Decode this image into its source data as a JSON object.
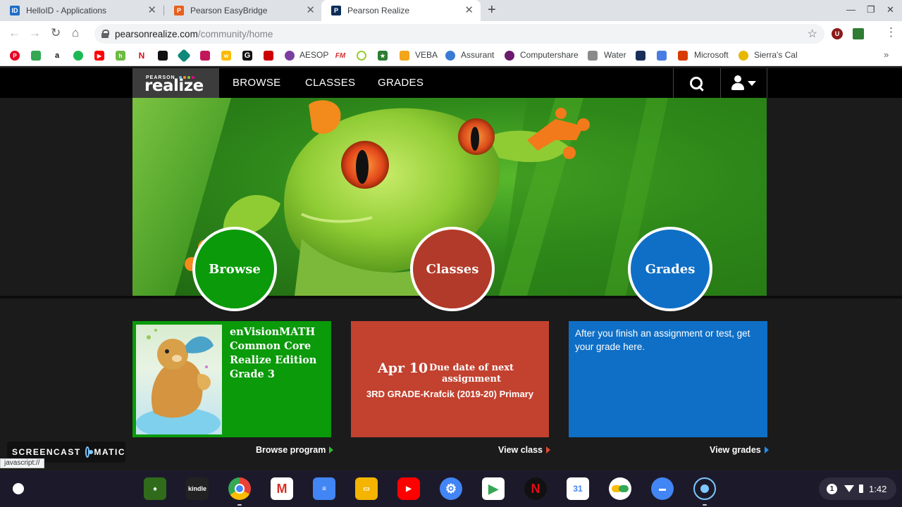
{
  "tabs": [
    {
      "label": "HelloID - Applications",
      "favicon": "HelloID",
      "favicon_text": "ID",
      "color": "#1f6fc8"
    },
    {
      "label": "Pearson EasyBridge",
      "favicon": "Pearson",
      "favicon_text": "P",
      "color": "#e8601c"
    },
    {
      "label": "Pearson Realize",
      "favicon": "Pearson",
      "favicon_text": "P",
      "color": "#0c2d5a",
      "active": true
    }
  ],
  "address": {
    "host": "pearsonrealize.com",
    "path": "/community/home"
  },
  "bookmarks": [
    {
      "label": "AESOP",
      "color": "#7b3fa0",
      "icon": "aesop-icon"
    },
    {
      "label": "VEBA",
      "color": "#f3a51b",
      "icon": "veba-icon"
    },
    {
      "label": "Assurant",
      "color": "#3a7bd5",
      "icon": "assurant-icon"
    },
    {
      "label": "Computershare",
      "color": "#6a1b6e",
      "icon": "computershare-icon"
    },
    {
      "label": "Water",
      "color": "#8a8a8a",
      "icon": "water-icon"
    },
    {
      "label": "Microsoft",
      "color": "#d83b01",
      "icon": "microsoft-icon"
    },
    {
      "label": "Sierra's Cal",
      "color": "#e6b800",
      "icon": "sierra-icon"
    }
  ],
  "nav": {
    "logo_small": "PEARSON",
    "logo_main": "realize",
    "logo_dot_colors": [
      "#6ec1e4",
      "#f7941d",
      "#8dc63f",
      "#ec008c"
    ],
    "browse": "BROWSE",
    "classes": "CLASSES",
    "grades": "GRADES"
  },
  "circles": {
    "browse": {
      "label": "Browse",
      "color": "#0a9a0a"
    },
    "classes": {
      "label": "Classes",
      "color": "#b23a2a"
    },
    "grades": {
      "label": "Grades",
      "color": "#0f6fc6"
    }
  },
  "cards": {
    "browse": {
      "title_lines": [
        "enVisionMATH",
        "Common Core",
        "Realize Edition",
        "Grade 3"
      ],
      "link": "Browse program",
      "color": "#0a9a0a"
    },
    "classes": {
      "due_date": "Apr 10",
      "due_label": "Due date of next assignment",
      "class_name": "3RD GRADE-Krafcik (2019-20) Primary",
      "link": "View class",
      "color": "#c2412f"
    },
    "grades": {
      "message": "After you finish an assignment or test, get your grade here.",
      "link": "View grades",
      "color": "#0f6fc6"
    }
  },
  "watermark": {
    "left": "SCREENCAST",
    "right": "MATIC"
  },
  "status_bar": "javascript://",
  "tray": {
    "badge": "1",
    "time": "1:42"
  }
}
